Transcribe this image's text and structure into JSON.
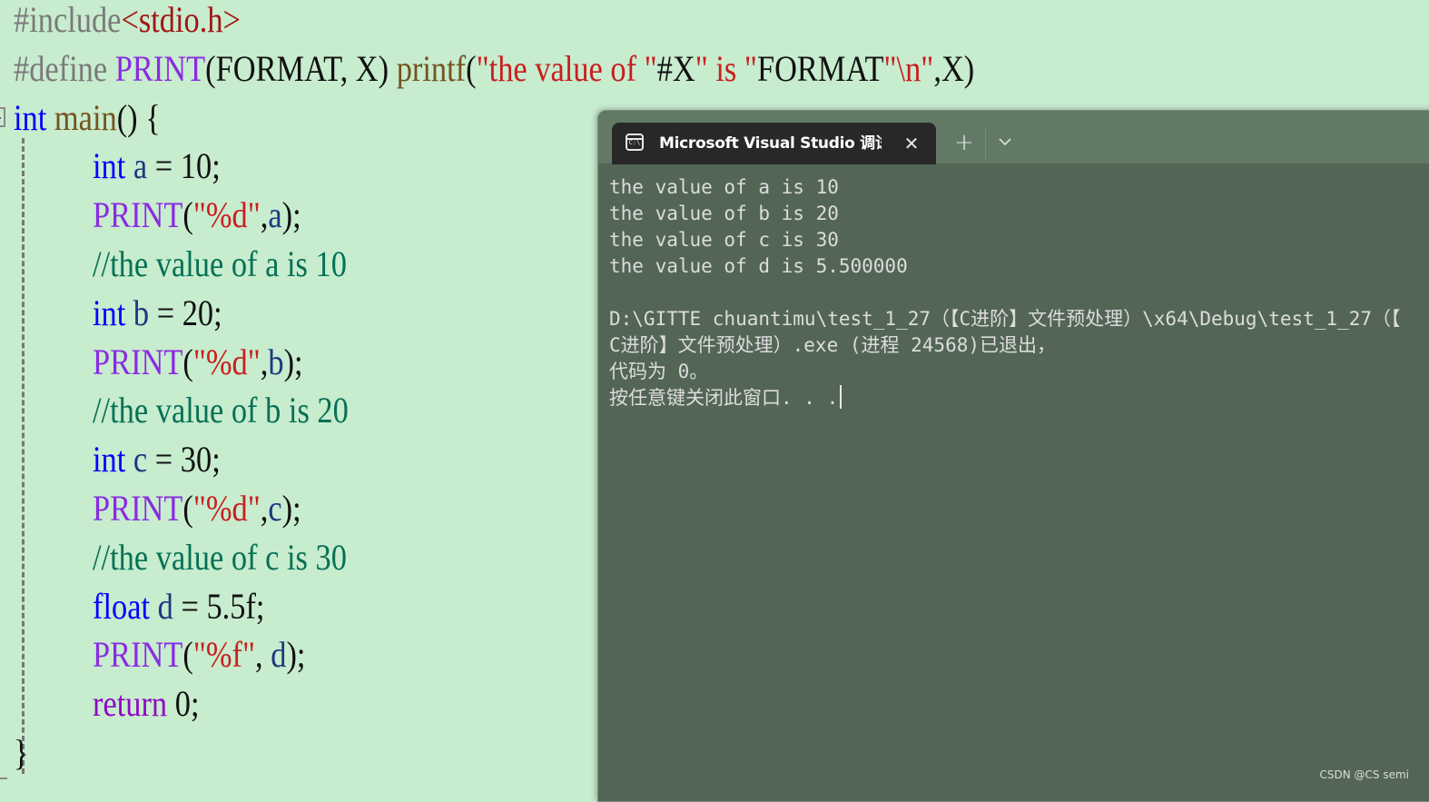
{
  "editor": {
    "lines": [
      {
        "parts": [
          {
            "t": "#include",
            "c": "c-pre"
          },
          {
            "t": "<stdio.h>",
            "c": "c-inc"
          }
        ]
      },
      {
        "parts": [
          {
            "t": "#define ",
            "c": "c-pre"
          },
          {
            "t": "PRINT",
            "c": "c-macro"
          },
          {
            "t": "(FORMAT, X) ",
            "c": "c-plain"
          },
          {
            "t": "printf",
            "c": "c-func"
          },
          {
            "t": "(",
            "c": "c-plain"
          },
          {
            "t": "\"the value of \"",
            "c": "c-str"
          },
          {
            "t": "#X",
            "c": "c-plain"
          },
          {
            "t": "\" is \"",
            "c": "c-str"
          },
          {
            "t": "FORMAT",
            "c": "c-plain"
          },
          {
            "t": "\"\\n\"",
            "c": "c-str"
          },
          {
            "t": ",X)",
            "c": "c-plain"
          }
        ]
      },
      {
        "parts": [
          {
            "t": "int",
            "c": "c-kw"
          },
          {
            "t": " ",
            "c": "c-plain"
          },
          {
            "t": "main",
            "c": "c-func"
          },
          {
            "t": "() {",
            "c": "c-plain"
          }
        ]
      },
      {
        "indent": true,
        "parts": [
          {
            "t": "int",
            "c": "c-kw"
          },
          {
            "t": " ",
            "c": "c-plain"
          },
          {
            "t": "a",
            "c": "c-var"
          },
          {
            "t": " = 10;",
            "c": "c-plain"
          }
        ]
      },
      {
        "indent": true,
        "parts": [
          {
            "t": "PRINT",
            "c": "c-macro"
          },
          {
            "t": "(",
            "c": "c-plain"
          },
          {
            "t": "\"%d\"",
            "c": "c-str"
          },
          {
            "t": ",",
            "c": "c-plain"
          },
          {
            "t": "a",
            "c": "c-var"
          },
          {
            "t": ");",
            "c": "c-plain"
          }
        ]
      },
      {
        "indent": true,
        "parts": [
          {
            "t": "//the value of a is 10",
            "c": "c-com"
          }
        ]
      },
      {
        "indent": true,
        "parts": [
          {
            "t": "int",
            "c": "c-kw"
          },
          {
            "t": " ",
            "c": "c-plain"
          },
          {
            "t": "b",
            "c": "c-var"
          },
          {
            "t": " = 20;",
            "c": "c-plain"
          }
        ]
      },
      {
        "indent": true,
        "parts": [
          {
            "t": "PRINT",
            "c": "c-macro"
          },
          {
            "t": "(",
            "c": "c-plain"
          },
          {
            "t": "\"%d\"",
            "c": "c-str"
          },
          {
            "t": ",",
            "c": "c-plain"
          },
          {
            "t": "b",
            "c": "c-var"
          },
          {
            "t": ");",
            "c": "c-plain"
          }
        ]
      },
      {
        "indent": true,
        "parts": [
          {
            "t": "//the value of b is 20",
            "c": "c-com"
          }
        ]
      },
      {
        "indent": true,
        "parts": [
          {
            "t": "int",
            "c": "c-kw"
          },
          {
            "t": " ",
            "c": "c-plain"
          },
          {
            "t": "c",
            "c": "c-var"
          },
          {
            "t": " = 30;",
            "c": "c-plain"
          }
        ]
      },
      {
        "indent": true,
        "parts": [
          {
            "t": "PRINT",
            "c": "c-macro"
          },
          {
            "t": "(",
            "c": "c-plain"
          },
          {
            "t": "\"%d\"",
            "c": "c-str"
          },
          {
            "t": ",",
            "c": "c-plain"
          },
          {
            "t": "c",
            "c": "c-var"
          },
          {
            "t": ");",
            "c": "c-plain"
          }
        ]
      },
      {
        "indent": true,
        "parts": [
          {
            "t": "//the value of c is 30",
            "c": "c-com"
          }
        ]
      },
      {
        "indent": true,
        "parts": [
          {
            "t": "float",
            "c": "c-kw"
          },
          {
            "t": " ",
            "c": "c-plain"
          },
          {
            "t": "d",
            "c": "c-var"
          },
          {
            "t": " = 5.5f;",
            "c": "c-plain"
          }
        ]
      },
      {
        "indent": true,
        "parts": [
          {
            "t": "PRINT",
            "c": "c-macro"
          },
          {
            "t": "(",
            "c": "c-plain"
          },
          {
            "t": "\"%f\"",
            "c": "c-str"
          },
          {
            "t": ", ",
            "c": "c-plain"
          },
          {
            "t": "d",
            "c": "c-var"
          },
          {
            "t": ");",
            "c": "c-plain"
          }
        ]
      },
      {
        "indent": true,
        "parts": [
          {
            "t": "return",
            "c": "c-ret"
          },
          {
            "t": " 0;",
            "c": "c-plain"
          }
        ]
      },
      {
        "parts": [
          {
            "t": "}",
            "c": "c-plain"
          }
        ]
      }
    ]
  },
  "terminal": {
    "tab_title": "Microsoft Visual Studio 调试控制台",
    "tab_icon": "C:\\",
    "close_glyph": "✕",
    "new_tab_glyph": "+",
    "output": [
      "the value of a is 10",
      "the value of b is 20",
      "the value of c is 30",
      "the value of d is 5.500000",
      "",
      "D:\\GITTE chuantimu\\test_1_27（【C进阶】文件预处理）\\x64\\Debug\\test_1_27（【",
      "C进阶】文件预处理）.exe (进程 24568)已退出，",
      "代码为 0。",
      "按任意键关闭此窗口. . ."
    ]
  },
  "watermark": "CSDN @CS semi",
  "colors": {
    "editor_background": "#c7ecce",
    "terminal_background": "#536656",
    "tabbar_background": "#627a65",
    "active_tab_background": "#282828",
    "terminal_text": "#dcdcdc"
  }
}
